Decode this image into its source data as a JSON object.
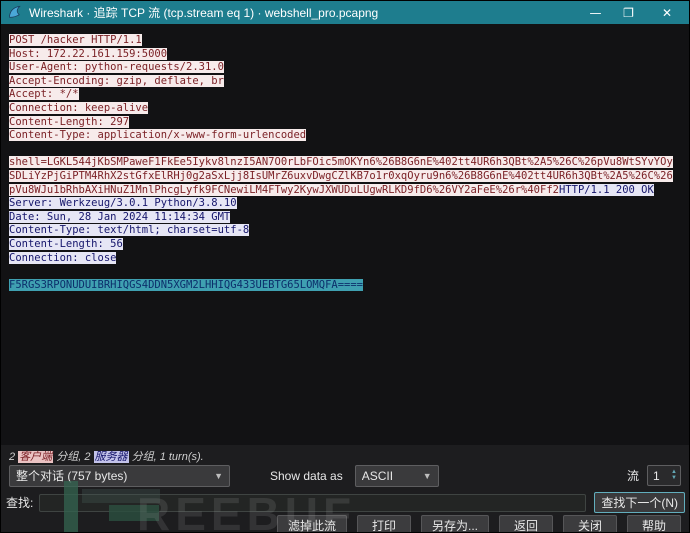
{
  "window": {
    "title": "Wireshark · 追踪 TCP 流 (tcp.stream eq 1) · webshell_pro.pcapng",
    "minimize_glyph": "—",
    "maximize_glyph": "❐",
    "close_glyph": "✕"
  },
  "stream": {
    "lines": [
      {
        "segs": [
          {
            "t": "POST /hacker HTTP/1.1",
            "k": "client"
          }
        ]
      },
      {
        "segs": [
          {
            "t": "Host: 172.22.161.159:5000",
            "k": "client"
          }
        ]
      },
      {
        "segs": [
          {
            "t": "User-Agent: python-requests/2.31.0",
            "k": "client"
          }
        ]
      },
      {
        "segs": [
          {
            "t": "Accept-Encoding: gzip, deflate, br",
            "k": "client"
          }
        ]
      },
      {
        "segs": [
          {
            "t": "Accept: */*",
            "k": "client"
          }
        ]
      },
      {
        "segs": [
          {
            "t": "Connection: keep-alive",
            "k": "client"
          }
        ]
      },
      {
        "segs": [
          {
            "t": "Content-Length: 297",
            "k": "client"
          }
        ]
      },
      {
        "segs": [
          {
            "t": "Content-Type: application/x-www-form-urlencoded",
            "k": "client"
          }
        ]
      },
      {
        "segs": []
      },
      {
        "segs": [
          {
            "t": "shell=LGKL544jKbSMPaweF1FkEe5Iykv8lnzI5AN7O0rLbFOic5mOKYn6%26B8G6nE%402tt4UR6h3QBt%2A5%26C%26pVu8WtSYvYOy",
            "k": "client"
          }
        ]
      },
      {
        "segs": [
          {
            "t": "SDLiYzPjGiPTM4RhX2stGfxElRHj0g2aSxLjj8IsUMrZ6uxvDwgCZlKB7o1r0xqOyru9n6%26B8G6nE%402tt4UR6h3QBt%2A5%26C%26",
            "k": "client"
          }
        ]
      },
      {
        "segs": [
          {
            "t": "pVu8WJu1bRhbAXiHNuZ1MnlPhcgLyfk9FCNewiLM4FTwy2KywJXWUDuLUgwRLKD9fD6%26VY2aFeE%26r%40Ff2",
            "k": "client"
          },
          {
            "t": "HTTP/1.1 200 OK",
            "k": "server"
          }
        ]
      },
      {
        "segs": [
          {
            "t": "Server: Werkzeug/3.0.1 Python/3.8.10",
            "k": "server"
          }
        ]
      },
      {
        "segs": [
          {
            "t": "Date: Sun, 28 Jan 2024 11:14:34 GMT",
            "k": "server"
          }
        ]
      },
      {
        "segs": [
          {
            "t": "Content-Type: text/html; charset=utf-8",
            "k": "server"
          }
        ]
      },
      {
        "segs": [
          {
            "t": "Content-Length: 56",
            "k": "server"
          }
        ]
      },
      {
        "segs": [
          {
            "t": "Connection: close",
            "k": "server"
          }
        ]
      },
      {
        "segs": []
      },
      {
        "segs": [
          {
            "t": "F5RGS3RPONUDUIBRHIQGS4DDN5XGM2LHHIQG433UEBTG65LOMQFA====",
            "k": "selected"
          }
        ]
      }
    ]
  },
  "stats": {
    "segments": [
      {
        "t": "2 ",
        "k": "plain"
      },
      {
        "t": "客户端",
        "k": "client-tag"
      },
      {
        "t": " 分组, 2 ",
        "k": "plain"
      },
      {
        "t": "服务器",
        "k": "server-tag"
      },
      {
        "t": " 分组, 1 turn(s).",
        "k": "plain"
      }
    ]
  },
  "controls": {
    "range_selector_value": "整个对话  (757 bytes)",
    "show_data_as_label": "Show data as",
    "format_selector_value": "ASCII",
    "stream_label": "流",
    "stream_value": "1"
  },
  "find": {
    "label": "查找:",
    "value": "",
    "next_button_label": "查找下一个(N)"
  },
  "actions": [
    {
      "name": "filter-out-stream-button",
      "label": "滤掉此流"
    },
    {
      "name": "print-button",
      "label": "打印"
    },
    {
      "name": "save-as-button",
      "label": "另存为..."
    },
    {
      "name": "back-button",
      "label": "返回"
    },
    {
      "name": "close-button",
      "label": "关闭"
    },
    {
      "name": "help-button",
      "label": "帮助"
    }
  ],
  "watermark": {
    "text": "REEBUF"
  },
  "colors": {
    "titlebar": "#1e7d8e",
    "stream_background": "#121214",
    "client_text": "#7a1f24",
    "client_background": "#f7ebeb",
    "server_text": "#15156b",
    "server_background": "#e6e6f5",
    "selected_text": "#0c2f6b",
    "selected_background": "#3fa0b1",
    "footer_background": "#1d1d1f"
  }
}
